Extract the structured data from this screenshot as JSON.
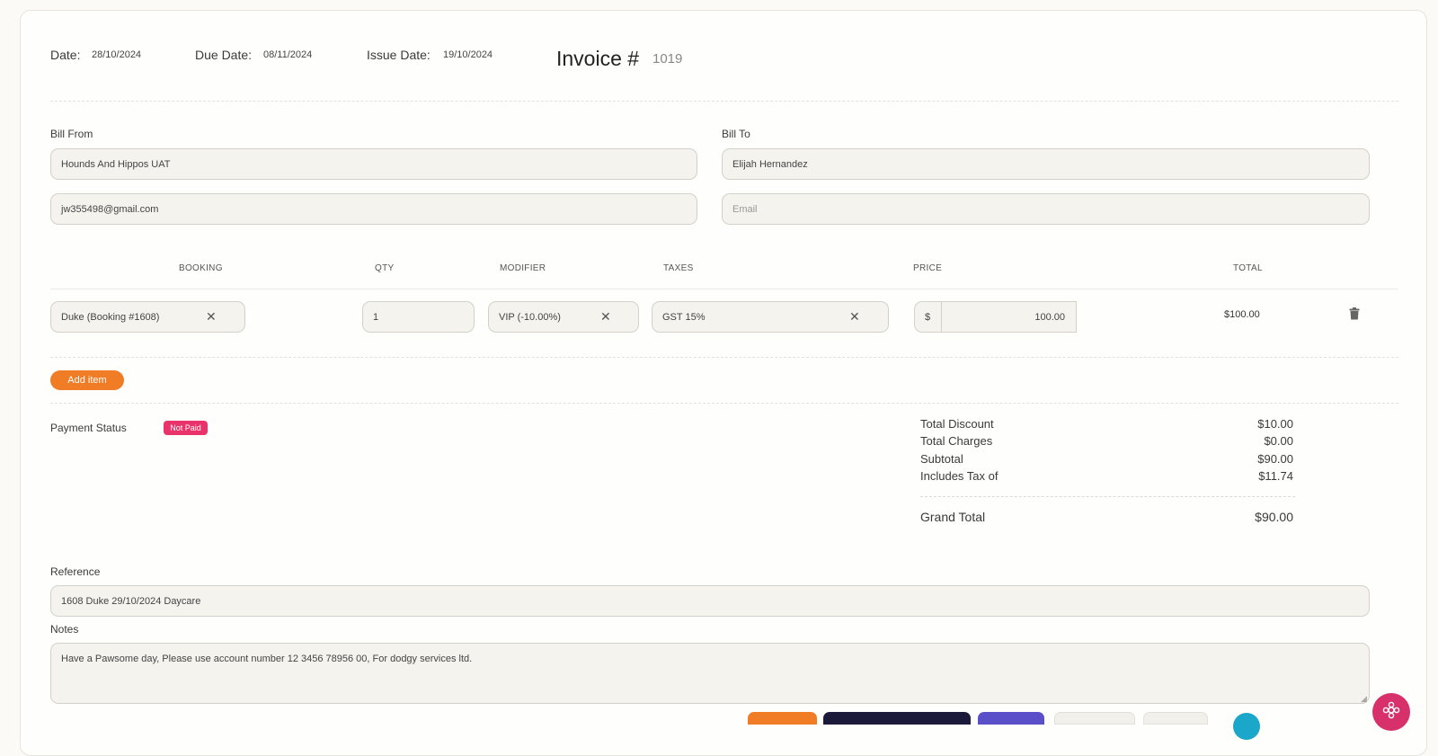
{
  "header": {
    "date_label": "Date:",
    "date_value": "28/10/2024",
    "due_label": "Due Date:",
    "due_value": "08/11/2024",
    "issue_label": "Issue Date:",
    "issue_value": "19/10/2024",
    "invoice_label": "Invoice #",
    "invoice_number": "1019"
  },
  "bill_from": {
    "label": "Bill From",
    "name": "Hounds And Hippos UAT",
    "email": "jw355498@gmail.com"
  },
  "bill_to": {
    "label": "Bill To",
    "name": "Elijah Hernandez",
    "email_placeholder": "Email"
  },
  "items_table": {
    "columns": [
      "BOOKING",
      "QTY",
      "MODIFIER",
      "TAXES",
      "PRICE",
      "TOTAL"
    ],
    "rows": [
      {
        "booking": "Duke (Booking #1608)",
        "qty": "1",
        "modifier": "VIP (-10.00%)",
        "taxes": "GST 15%",
        "currency": "$",
        "price": "100.00",
        "total": "$100.00"
      }
    ],
    "add_item_label": "Add item"
  },
  "payment": {
    "label": "Payment Status",
    "status": "Not Paid",
    "status_color": "#e8336b"
  },
  "summary": {
    "total_discount_label": "Total Discount",
    "total_discount": "$10.00",
    "total_charges_label": "Total Charges",
    "total_charges": "$0.00",
    "subtotal_label": "Subtotal",
    "subtotal": "$90.00",
    "tax_label": "Includes Tax of",
    "tax": "$11.74",
    "grand_total_label": "Grand Total",
    "grand_total": "$90.00"
  },
  "reference": {
    "label": "Reference",
    "value": "1608 Duke 29/10/2024 Daycare"
  },
  "notes": {
    "label": "Notes",
    "value": "Have a Pawsome day, Please use  account number 12 3456 78956 00, For dodgy services ltd."
  },
  "colors": {
    "accent": "#f07d26",
    "field_bg": "#f4f3ee",
    "navy": "#1b1a3a",
    "purple": "#5b4ec9",
    "pink": "#d8306a"
  }
}
